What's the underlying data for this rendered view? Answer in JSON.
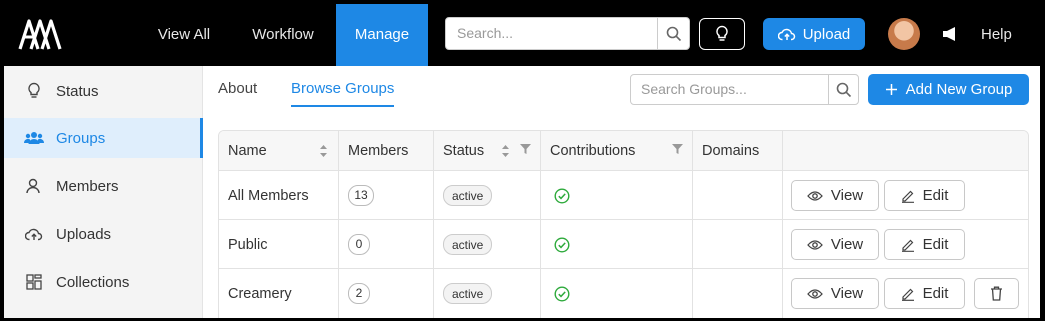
{
  "nav": {
    "logo": "logo",
    "links": [
      {
        "label": "View All",
        "active": false
      },
      {
        "label": "Workflow",
        "active": false
      },
      {
        "label": "Manage",
        "active": true
      }
    ],
    "search_placeholder": "Search...",
    "upload_label": "Upload",
    "help_label": "Help",
    "accent_color": "#1e88e5"
  },
  "sidebar": {
    "items": [
      {
        "label": "Status",
        "icon": "lightbulb-icon",
        "active": false
      },
      {
        "label": "Groups",
        "icon": "users-icon",
        "active": true
      },
      {
        "label": "Members",
        "icon": "person-icon",
        "active": false
      },
      {
        "label": "Uploads",
        "icon": "cloud-upload-icon",
        "active": false
      },
      {
        "label": "Collections",
        "icon": "collections-icon",
        "active": false
      }
    ]
  },
  "main": {
    "tabs": [
      {
        "label": "About",
        "active": false
      },
      {
        "label": "Browse Groups",
        "active": true
      }
    ],
    "group_search_placeholder": "Search Groups...",
    "add_group_label": "Add New Group",
    "table": {
      "columns": [
        "Name",
        "Members",
        "Status",
        "Contributions",
        "Domains"
      ],
      "rows": [
        {
          "name": "All Members",
          "members": "13",
          "status": "active",
          "contributions": "check-circle-icon",
          "domains": "",
          "actions": [
            "View",
            "Edit"
          ]
        },
        {
          "name": "Public",
          "members": "0",
          "status": "active",
          "contributions": "check-circle-icon",
          "domains": "",
          "actions": [
            "View",
            "Edit"
          ]
        },
        {
          "name": "Creamery",
          "members": "2",
          "status": "active",
          "contributions": "check-circle-icon",
          "domains": "",
          "actions": [
            "View",
            "Edit",
            "Delete"
          ]
        }
      ]
    }
  }
}
